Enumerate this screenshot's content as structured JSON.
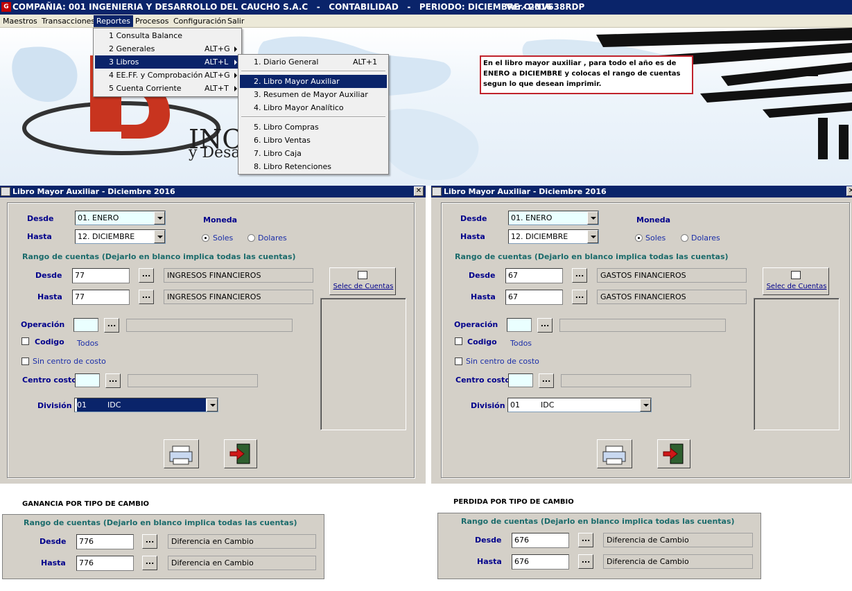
{
  "titlebar": {
    "title": "COMPAÑIA: 001 INGENIERIA Y DESARROLLO DEL CAUCHO S.A.C   -   CONTABILIDAD   -   PERIODO: DICIEMBRE - 2016",
    "version": "Ver.O-NV638RDP"
  },
  "menubar": {
    "items": [
      "Maestros",
      "Transacciones",
      "Reportes",
      "Procesos",
      "Configuración",
      "Salir"
    ],
    "active": "Reportes"
  },
  "reportes_menu": {
    "items": [
      {
        "label": "1 Consulta Balance",
        "shortcut": ""
      },
      {
        "label": "2 Generales",
        "shortcut": "ALT+G"
      },
      {
        "label": "3 Libros",
        "shortcut": "ALT+L"
      },
      {
        "label": "4 EE.FF. y Comprobación",
        "shortcut": "ALT+G"
      },
      {
        "label": "5 Cuenta Corriente",
        "shortcut": "ALT+T"
      }
    ]
  },
  "libros_menu": {
    "items": [
      {
        "label": "1. Diario General",
        "shortcut": "ALT+1"
      },
      {
        "label": "2. Libro Mayor Auxiliar",
        "shortcut": ""
      },
      {
        "label": "3. Resumen de Mayor Auxiliar",
        "shortcut": ""
      },
      {
        "label": "4. Libro Mayor Analítico",
        "shortcut": ""
      },
      {
        "label": "5. Libro Compras",
        "shortcut": ""
      },
      {
        "label": "6. Libro Ventas",
        "shortcut": ""
      },
      {
        "label": "7. Libro Caja",
        "shortcut": ""
      },
      {
        "label": "8. Libro Retenciones",
        "shortcut": ""
      }
    ]
  },
  "banner": {
    "logo_text_1": "INC",
    "logo_text_2": "y Desa"
  },
  "note": {
    "text": "En el libro mayor auxiliar , para todo el año es de ENERO a DICIEMBRE y colocas el rango de cuentas segun lo que desean imprimir."
  },
  "window_left": {
    "title": "Libro Mayor Auxiliar - Diciembre 2016",
    "close": "✕",
    "desde_label": "Desde",
    "hasta_label": "Hasta",
    "desde_month": "01. ENERO",
    "hasta_month": "12. DICIEMBRE",
    "moneda_label": "Moneda",
    "soles_label": "Soles",
    "dolares_label": "Dolares",
    "rango_label": "Rango de cuentas  (Dejarlo en blanco implica todas las cuentas)",
    "cta_desde": "77",
    "cta_hasta": "77",
    "cta_desde_desc": "INGRESOS FINANCIEROS",
    "cta_hasta_desc": "INGRESOS FINANCIEROS",
    "ellipsis": "...",
    "selec_label": "Selec de Cuentas",
    "operacion_label": "Operación",
    "codigo_label": "Codigo",
    "todos_label": "Todos",
    "sin_cc_label": "Sin centro de costo",
    "centro_label": "Centro costo",
    "division_label": "División",
    "division_code": "01",
    "division_name": "IDC"
  },
  "window_right": {
    "title": "Libro Mayor Auxiliar - Diciembre 2016",
    "close": "✕",
    "desde_label": "Desde",
    "hasta_label": "Hasta",
    "desde_month": "01. ENERO",
    "hasta_month": "12. DICIEMBRE",
    "moneda_label": "Moneda",
    "soles_label": "Soles",
    "dolares_label": "Dolares",
    "rango_label": "Rango de cuentas  (Dejarlo en blanco implica todas las cuentas)",
    "cta_desde": "67",
    "cta_hasta": "67",
    "cta_desde_desc": "GASTOS FINANCIEROS",
    "cta_hasta_desc": "GASTOS FINANCIEROS",
    "ellipsis": "...",
    "selec_label": "Selec de Cuentas",
    "operacion_label": "Operación",
    "codigo_label": "Codigo",
    "todos_label": "Todos",
    "sin_cc_label": "Sin centro de costo",
    "centro_label": "Centro costo",
    "division_label": "División",
    "division_code": "01",
    "division_name": "IDC"
  },
  "ganancia": {
    "heading": "GANANCIA POR TIPO DE CAMBIO",
    "rango_label": "Rango de cuentas  (Dejarlo en blanco implica todas las cuentas)",
    "desde_label": "Desde",
    "hasta_label": "Hasta",
    "cta_desde": "776",
    "cta_hasta": "776",
    "desc_desde": "Diferencia en Cambio",
    "desc_hasta": "Diferencia en Cambio",
    "ellipsis": "..."
  },
  "perdida": {
    "heading": "PERDIDA POR TIPO DE CAMBIO",
    "rango_label": "Rango de cuentas  (Dejarlo en blanco implica todas las cuentas)",
    "desde_label": "Desde",
    "hasta_label": "Hasta",
    "cta_desde": "676",
    "cta_hasta": "676",
    "desc_desde": "Diferencia de Cambio",
    "desc_hasta": "Diferencia de Cambio",
    "ellipsis": "..."
  },
  "colors": {
    "titlebar": "#0a246a",
    "note_border": "#c0232c",
    "label_navy": "#00008b",
    "label_teal": "#1b6b6b"
  }
}
